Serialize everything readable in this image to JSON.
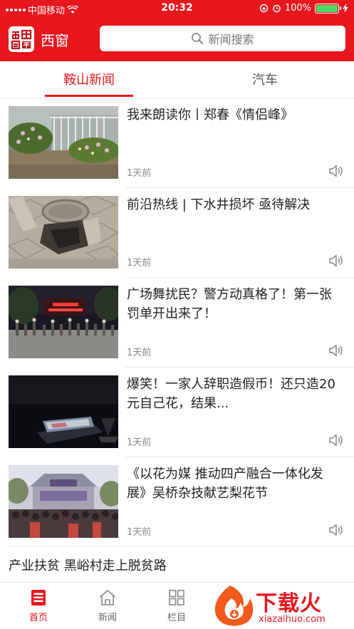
{
  "status_bar": {
    "carrier": "中国移动",
    "time": "20:32",
    "battery": "100%",
    "battery_level": 1.0
  },
  "header": {
    "logo_icon": "xichuang-seal-logo",
    "app_name": "西窗",
    "search_placeholder": "新闻搜索"
  },
  "tabs": [
    {
      "label": "鞍山新闻",
      "active": true
    },
    {
      "label": "汽车",
      "active": false
    }
  ],
  "news": [
    {
      "title": "我来朗读你丨郑春《情侣峰》",
      "time": "1天前"
    },
    {
      "title": "前沿热线 | 下水井损坏 亟待解决",
      "time": "1天前"
    },
    {
      "title": "广场舞扰民？警方动真格了！第一张罚单开出来了！",
      "time": "1天前"
    },
    {
      "title": "爆笑！一家人辞职造假币！还只造20元自己花，结果...",
      "time": "1天前"
    },
    {
      "title": "《以花为媒 推动四产融合一体化发展》吴桥杂技献艺梨花节",
      "time": "1天前"
    }
  ],
  "text_news": {
    "title": "产业扶贫 黑峪村走上脱贫路"
  },
  "bottom_nav": [
    {
      "label": "首页",
      "icon": "home-document-icon",
      "active": true
    },
    {
      "label": "新闻",
      "icon": "house-icon",
      "active": false
    },
    {
      "label": "栏目",
      "icon": "grid-icon",
      "active": false
    }
  ],
  "watermark": {
    "text": "下载火",
    "sub": "xiazaihuo.com"
  },
  "colors": {
    "brand": "#e8161d",
    "battery": "#4cd964"
  }
}
